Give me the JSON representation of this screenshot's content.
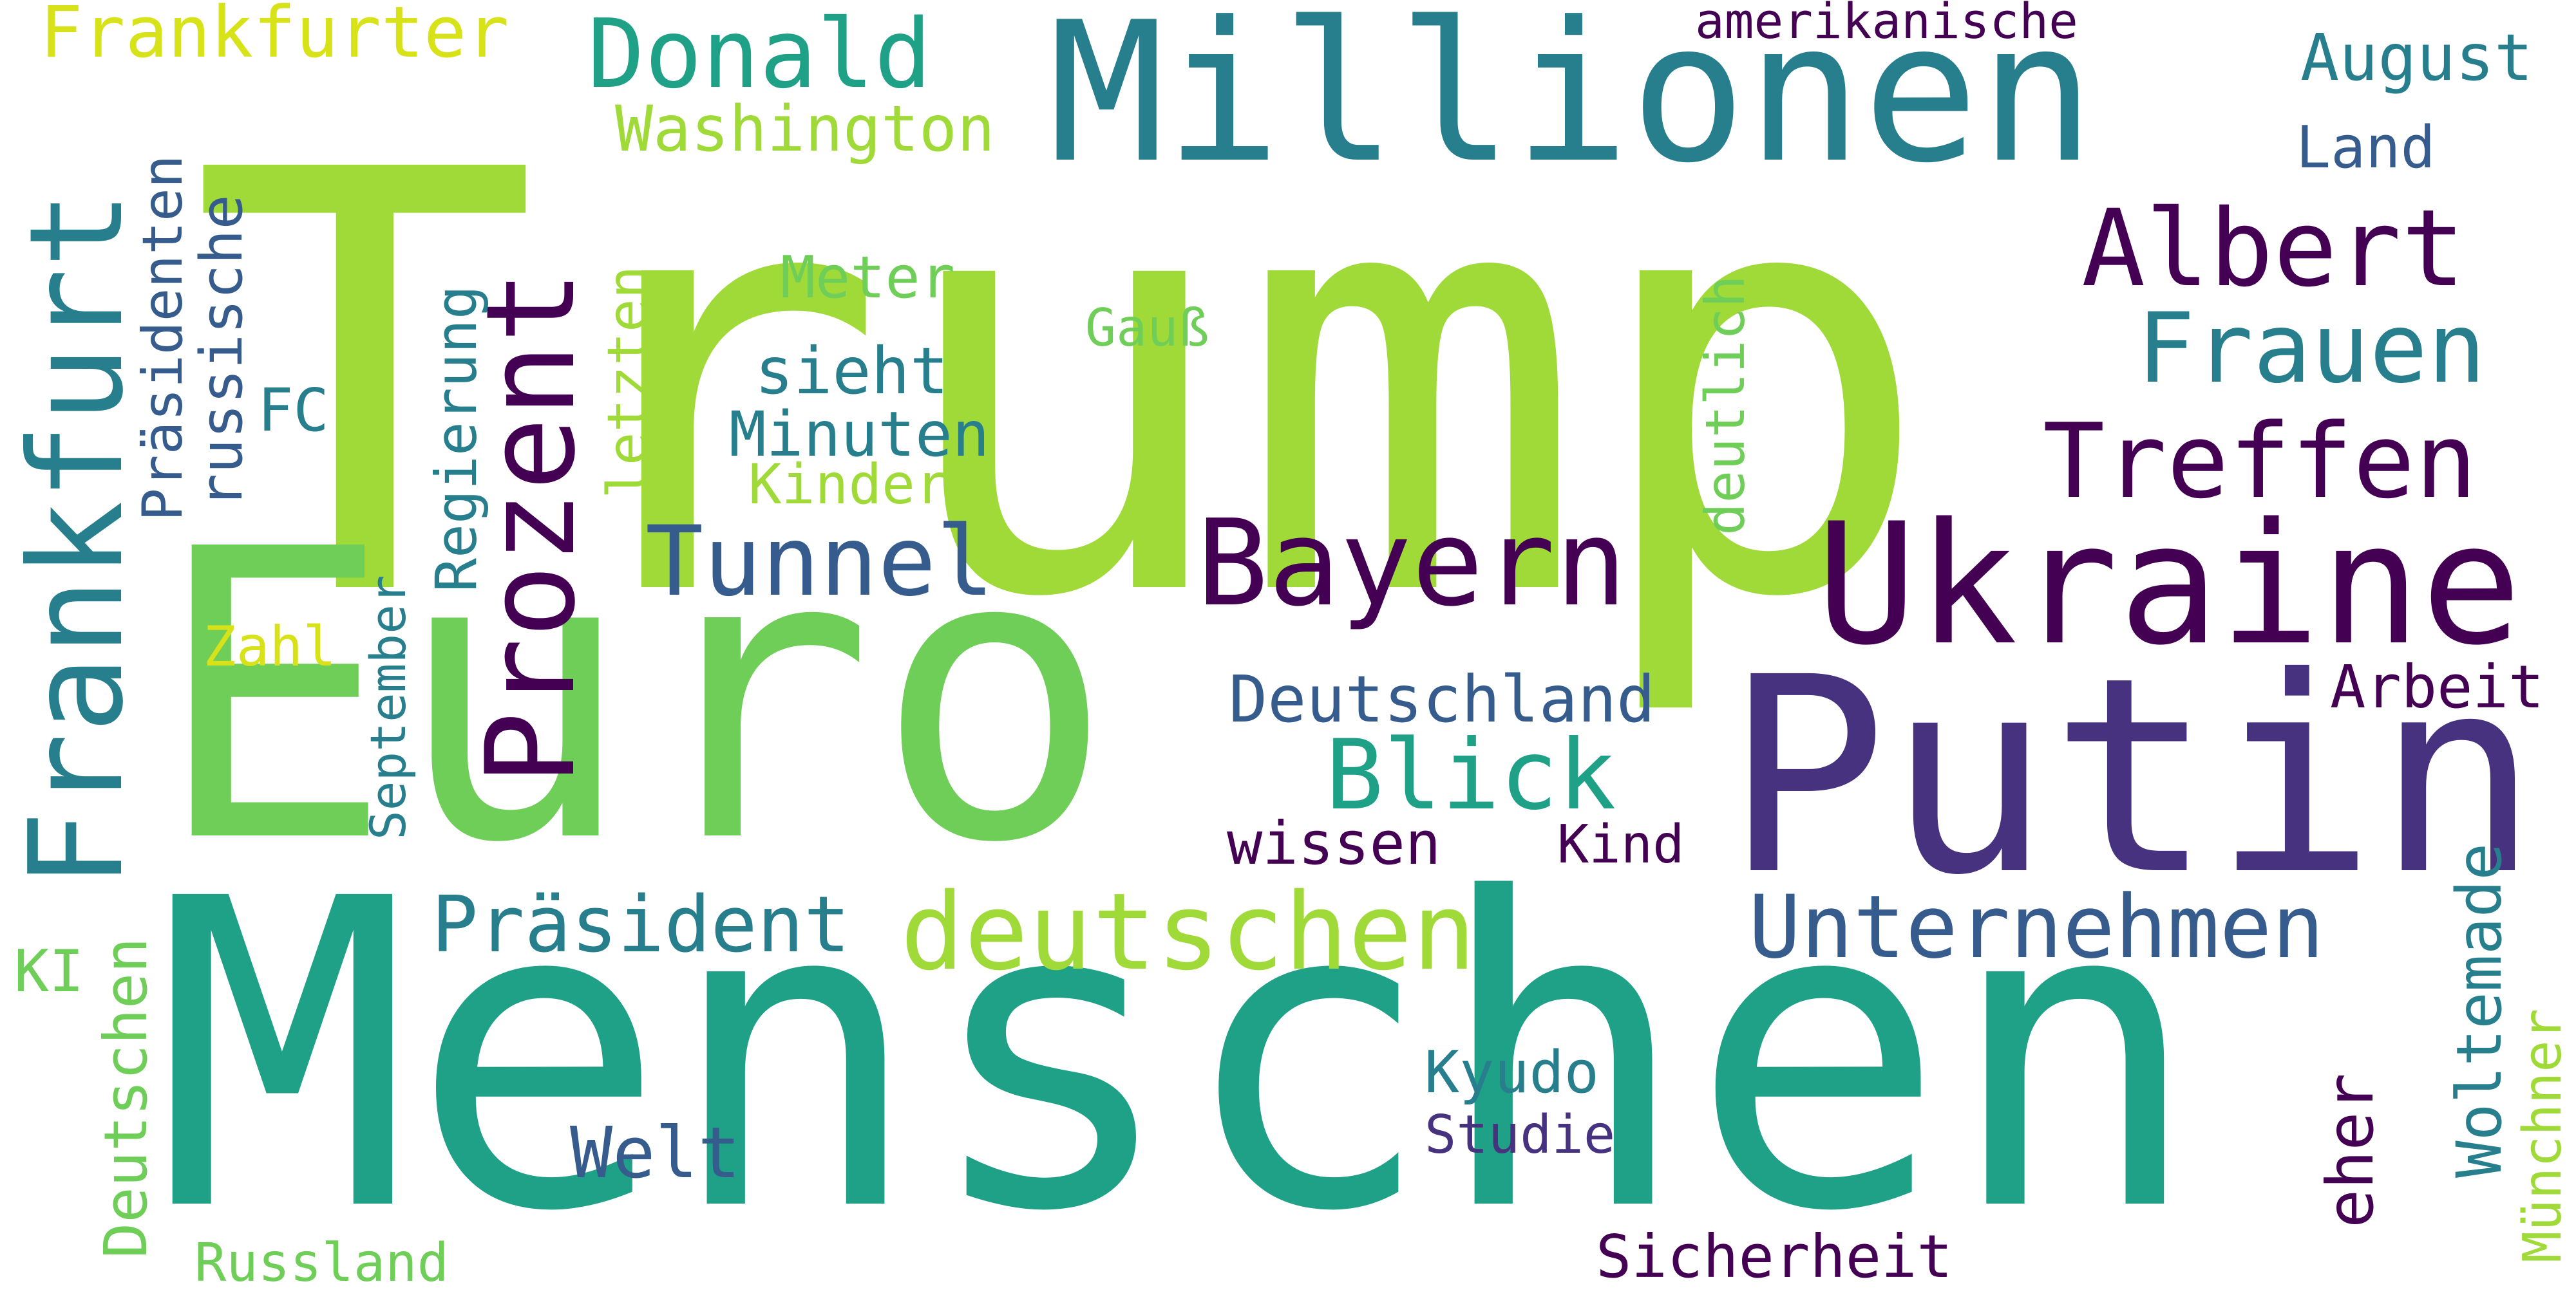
{
  "palette": {
    "lime": "#a0da39",
    "green": "#6ece58",
    "teal_green": "#1fa187",
    "teal": "#277f8e",
    "slate": "#365c8d",
    "indigo": "#46327e",
    "purple": "#440154",
    "yellow": "#d8e219"
  },
  "words": [
    {
      "text": "Trump"
    },
    {
      "text": "Euro"
    },
    {
      "text": "Menschen"
    },
    {
      "text": "Putin"
    },
    {
      "text": "Millionen"
    },
    {
      "text": "Ukraine"
    },
    {
      "text": "Frankfurt"
    },
    {
      "text": "Bayern"
    },
    {
      "text": "Prozent"
    },
    {
      "text": "deutschen"
    },
    {
      "text": "Albert"
    },
    {
      "text": "Treffen"
    },
    {
      "text": "Frauen"
    },
    {
      "text": "Tunnel"
    },
    {
      "text": "Blick"
    },
    {
      "text": "Unternehmen"
    },
    {
      "text": "Donald"
    },
    {
      "text": "Präsident"
    },
    {
      "text": "Deutschland"
    },
    {
      "text": "Welt"
    },
    {
      "text": "Washington"
    },
    {
      "text": "Frankfurter"
    },
    {
      "text": "August"
    },
    {
      "text": "eher"
    },
    {
      "text": "Woltemade"
    },
    {
      "text": "Deutschen"
    },
    {
      "text": "Arbeit"
    },
    {
      "text": "sieht"
    },
    {
      "text": "Minuten"
    },
    {
      "text": "Land"
    },
    {
      "text": "Meter"
    },
    {
      "text": "Kyudo"
    },
    {
      "text": "Sicherheit"
    },
    {
      "text": "wissen"
    },
    {
      "text": "russische"
    },
    {
      "text": "Präsidenten"
    },
    {
      "text": "Regierung"
    },
    {
      "text": "letzten"
    },
    {
      "text": "deutlich"
    },
    {
      "text": "Kinder"
    },
    {
      "text": "Studie"
    },
    {
      "text": "Russland"
    },
    {
      "text": "Münchner"
    },
    {
      "text": "Kind"
    },
    {
      "text": "Gauß"
    },
    {
      "text": "FC"
    },
    {
      "text": "Zahl"
    },
    {
      "text": "KI"
    },
    {
      "text": "September"
    },
    {
      "text": "amerikanische"
    }
  ]
}
